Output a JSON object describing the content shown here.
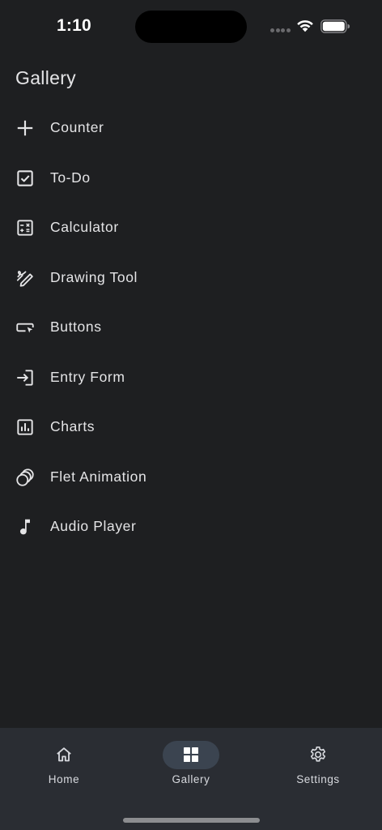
{
  "status_bar": {
    "time": "1:10"
  },
  "page": {
    "title": "Gallery"
  },
  "gallery": {
    "items": [
      {
        "label": "Counter",
        "icon": "add-icon"
      },
      {
        "label": "To-Do",
        "icon": "checkbox-icon"
      },
      {
        "label": "Calculator",
        "icon": "calculator-icon"
      },
      {
        "label": "Drawing Tool",
        "icon": "draw-icon"
      },
      {
        "label": "Buttons",
        "icon": "button-icon"
      },
      {
        "label": "Entry Form",
        "icon": "login-icon"
      },
      {
        "label": "Charts",
        "icon": "chart-icon"
      },
      {
        "label": "Flet Animation",
        "icon": "animation-icon"
      },
      {
        "label": "Audio Player",
        "icon": "music-note-icon"
      }
    ]
  },
  "bottom_nav": {
    "items": [
      {
        "label": "Home",
        "icon": "home-icon",
        "active": false
      },
      {
        "label": "Gallery",
        "icon": "grid-icon",
        "active": true
      },
      {
        "label": "Settings",
        "icon": "gear-icon",
        "active": false
      }
    ]
  },
  "colors": {
    "background": "#1e1f21",
    "nav_background": "#2a2d33",
    "active_pill": "#3b4450",
    "text": "#e4e4e6"
  }
}
